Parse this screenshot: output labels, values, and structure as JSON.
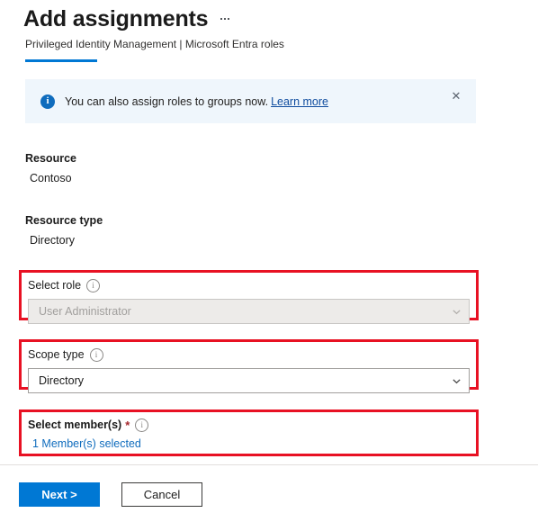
{
  "header": {
    "title": "Add assignments",
    "subtitle": "Privileged Identity Management | Microsoft Entra roles",
    "overflow_menu_label": "..."
  },
  "banner": {
    "icon": "info-icon",
    "message": "You can also assign roles to groups now.",
    "link_text": "Learn more",
    "close_label": "✕",
    "background_color": "#eff6fc",
    "icon_color": "#0f6cbd"
  },
  "fields": {
    "resource": {
      "label": "Resource",
      "value": "Contoso"
    },
    "resource_type": {
      "label": "Resource type",
      "value": "Directory"
    },
    "select_role": {
      "label": "Select role",
      "info_icon": "info-circle-icon",
      "value": "User Administrator",
      "disabled": true,
      "chevron": "chevron-down-icon",
      "highlighted": true
    },
    "scope_type": {
      "label": "Scope type",
      "info_icon": "info-circle-icon",
      "value": "Directory",
      "disabled": false,
      "chevron": "chevron-down-icon",
      "highlighted": true
    },
    "select_members": {
      "label": "Select member(s)",
      "required_marker": "*",
      "info_icon": "info-circle-icon",
      "link_text": "1 Member(s) selected",
      "highlighted": true
    }
  },
  "footer": {
    "next_label": "Next >",
    "cancel_label": "Cancel"
  },
  "colors": {
    "accent": "#0078d4",
    "highlight_border": "#e81123",
    "link": "#0f6cbd",
    "required": "#a4262c"
  }
}
